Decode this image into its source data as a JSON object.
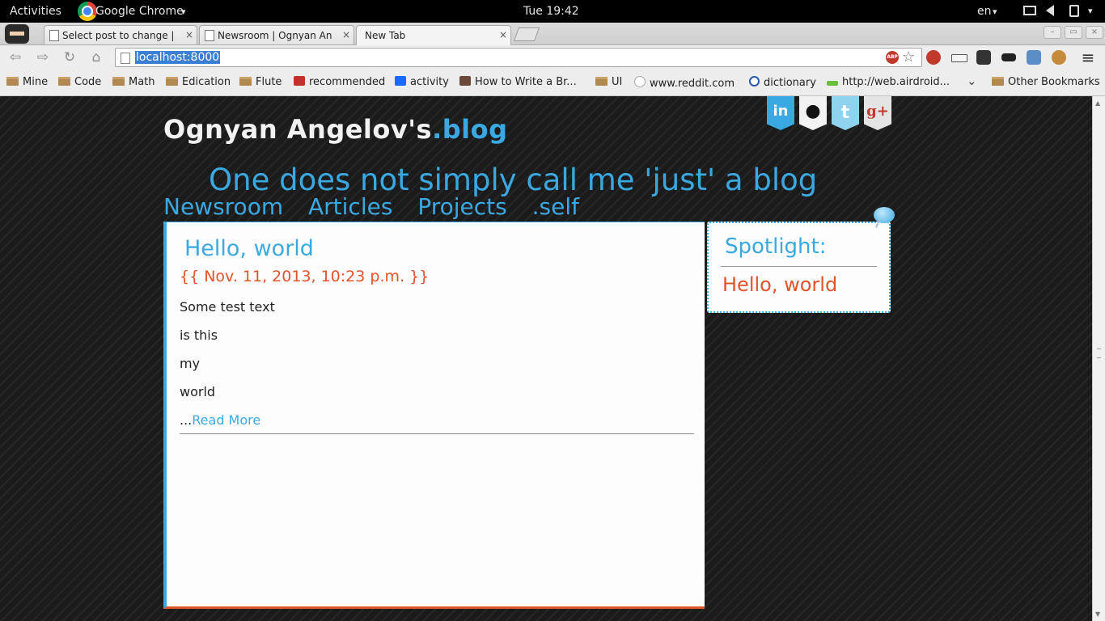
{
  "system_bar": {
    "activities": "Activities",
    "app_name": "Google Chrome",
    "app_caret": "▾",
    "clock": "Tue 19:42",
    "lang": "en",
    "lang_caret": "▾"
  },
  "tabs": [
    {
      "title": "Select post to change | Dj",
      "close": "×"
    },
    {
      "title": "Newsroom | Ognyan Ange",
      "close": "×"
    },
    {
      "title": "New Tab",
      "close": "×"
    }
  ],
  "toolbar": {
    "url": "localhost:8000",
    "abp": "ABP",
    "menu": "≡"
  },
  "bookmarks": [
    {
      "label": "Mine",
      "icon": "folder-icon"
    },
    {
      "label": "Code",
      "icon": "folder-icon"
    },
    {
      "label": "Math",
      "icon": "folder-icon"
    },
    {
      "label": "Edication",
      "icon": "folder-icon"
    },
    {
      "label": "Flute",
      "icon": "folder-icon"
    },
    {
      "label": "recommended",
      "icon": "youtube-icon"
    },
    {
      "label": "activity",
      "icon": "behance-icon"
    },
    {
      "label": "How to Write a Br...",
      "icon": "avatar-icon"
    },
    {
      "label": "UI",
      "icon": "folder-icon"
    },
    {
      "label": "www.reddit.com",
      "icon": "reddit-icon"
    },
    {
      "label": "dictionary",
      "icon": "dictionary-icon"
    },
    {
      "label": "http://web.airdroid...",
      "icon": "airdroid-icon"
    },
    {
      "label": "Other Bookmarks",
      "icon": "folder-icon"
    }
  ],
  "bookmarks_more": "⌄",
  "site": {
    "title_main": "Ognyan Angelov's",
    "title_accent": ".blog",
    "tagline": "One does not simply call me 'just' a blog",
    "nav": [
      "Newsroom",
      "Articles",
      "Projects",
      ".self"
    ],
    "social": [
      {
        "name": "linkedin-icon",
        "glyph": "in",
        "color": "#3aa9e2"
      },
      {
        "name": "github-icon",
        "glyph": "●",
        "color": "#f2f2f2"
      },
      {
        "name": "twitter-icon",
        "glyph": "t",
        "color": "#8fd3ef"
      },
      {
        "name": "googleplus-icon",
        "glyph": "g+",
        "color": "#e4e4e4"
      }
    ]
  },
  "post": {
    "title": "Hello, world",
    "date": "{{ Nov. 11, 2013, 10:23 p.m. }}",
    "lines": [
      "Some test text",
      "is this",
      "my",
      "world"
    ],
    "ellipsis": "...",
    "read_more": "Read More"
  },
  "spotlight": {
    "title": "Spotlight:",
    "item": "Hello, world"
  }
}
